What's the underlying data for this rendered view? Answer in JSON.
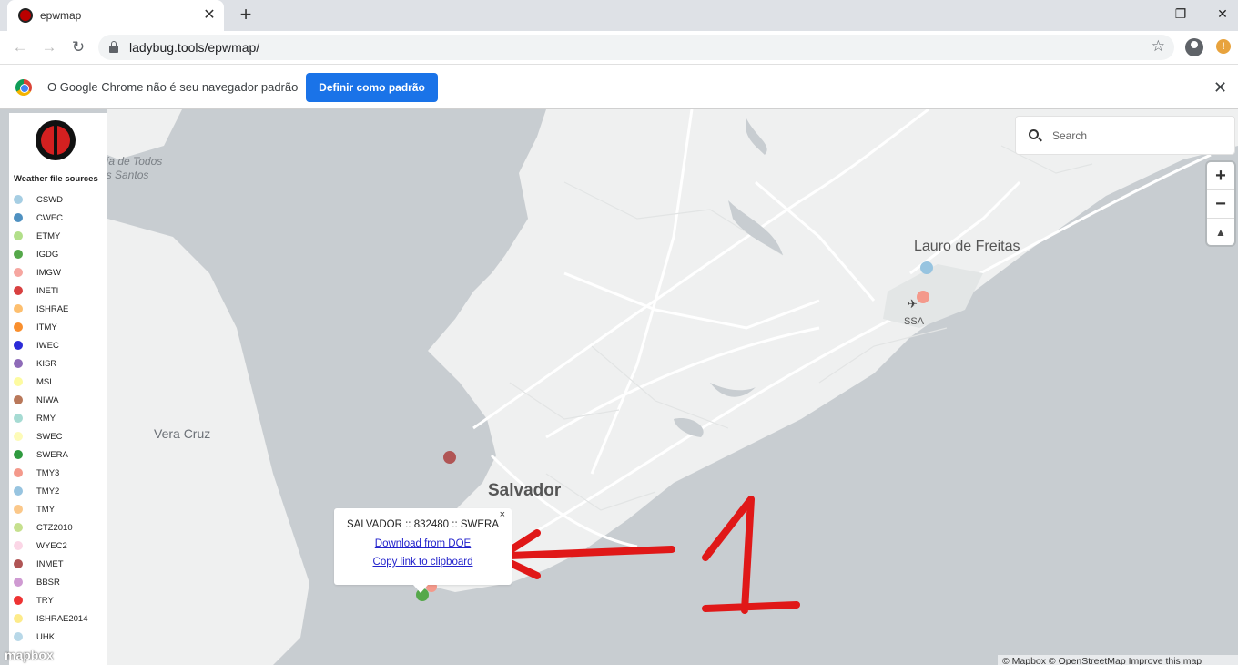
{
  "browser": {
    "tab_title": "epwmap",
    "tab_close": "✕",
    "new_tab": "+",
    "url": "ladybug.tools/epwmap/",
    "window_controls": {
      "minimize": "—",
      "restore": "❐",
      "close": "✕"
    },
    "alert_badge": "!"
  },
  "infobar": {
    "message": "O Google Chrome não é seu navegador padrão",
    "button_label": "Definir como padrão",
    "close": "✕"
  },
  "legend": {
    "title": "Weather file sources",
    "items": [
      {
        "label": "CSWD",
        "color": "#a6cee3"
      },
      {
        "label": "CWEC",
        "color": "#4f91c1"
      },
      {
        "label": "ETMY",
        "color": "#b2df8a"
      },
      {
        "label": "IGDG",
        "color": "#55a84a"
      },
      {
        "label": "IMGW",
        "color": "#f6a6a0"
      },
      {
        "label": "INETI",
        "color": "#d84040"
      },
      {
        "label": "ISHRAE",
        "color": "#fdbf6f"
      },
      {
        "label": "ITMY",
        "color": "#f98f2e"
      },
      {
        "label": "IWEC",
        "color": "#2b2bd8"
      },
      {
        "label": "KISR",
        "color": "#8e6bb8"
      },
      {
        "label": "MSI",
        "color": "#fdfba0"
      },
      {
        "label": "NIWA",
        "color": "#b9785a"
      },
      {
        "label": "RMY",
        "color": "#a6dbd3"
      },
      {
        "label": "SWEC",
        "color": "#fdfbb8"
      },
      {
        "label": "SWERA",
        "color": "#2f9a3f"
      },
      {
        "label": "TMY3",
        "color": "#f4998b"
      },
      {
        "label": "TMY2",
        "color": "#97c4e0"
      },
      {
        "label": "TMY",
        "color": "#fbc88a"
      },
      {
        "label": "CTZ2010",
        "color": "#c6e08e"
      },
      {
        "label": "WYEC2",
        "color": "#fbd6e6"
      },
      {
        "label": "INMET",
        "color": "#b05555"
      },
      {
        "label": "BBSR",
        "color": "#cf9ad2"
      },
      {
        "label": "TRY",
        "color": "#ee3333"
      },
      {
        "label": "ISHRAE2014",
        "color": "#fdeb8a"
      },
      {
        "label": "UHK",
        "color": "#b8d8e8"
      }
    ]
  },
  "search": {
    "placeholder": "Search"
  },
  "zoom": {
    "in": "+",
    "out": "−",
    "compass": "▲"
  },
  "map_labels": {
    "baia_1": "ía de Todos",
    "baia_2": "os Santos",
    "vera_cruz": "Vera Cruz",
    "salvador": "Salvador",
    "lauro": "Lauro de Freitas",
    "airport": "SSA",
    "airport_icon": "✈"
  },
  "popup": {
    "title": "SALVADOR :: 832480 :: SWERA",
    "download": "Download from DOE",
    "copy": "Copy link to clipboard",
    "close": "×"
  },
  "annotation": {
    "number": "1",
    "color": "#e01818"
  },
  "footer": {
    "mapbox": "mapbox",
    "attribution": "© Mapbox © OpenStreetMap Improve this map"
  }
}
